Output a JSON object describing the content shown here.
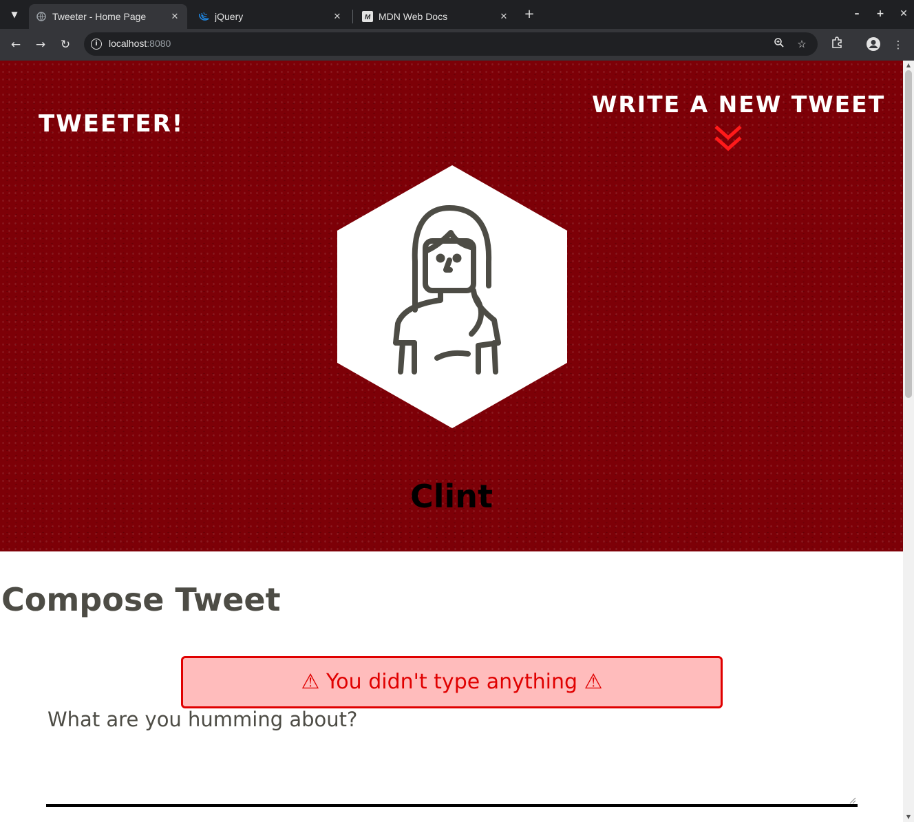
{
  "browser": {
    "tabs": [
      {
        "title": "Tweeter - Home Page",
        "icon": "globe-icon",
        "active": true
      },
      {
        "title": "jQuery",
        "icon": "jquery-icon",
        "active": false
      },
      {
        "title": "MDN Web Docs",
        "icon": "mdn-icon",
        "active": false
      }
    ],
    "url_host": "localhost",
    "url_port": ":8080"
  },
  "page": {
    "brand": "Tweeter!",
    "write_new_tweet": "Write a new tweet",
    "username": "Clint",
    "compose_title": "Compose Tweet",
    "error_message": "⚠ You didn't type anything ⚠",
    "tweet_placeholder": "What are you humming about?"
  },
  "colors": {
    "hero_bg": "#7d0007",
    "accent_red": "#ff1a1a",
    "error_bg": "#ffbcbc",
    "error_border": "#e00000",
    "text_dark": "#4d4c45"
  }
}
